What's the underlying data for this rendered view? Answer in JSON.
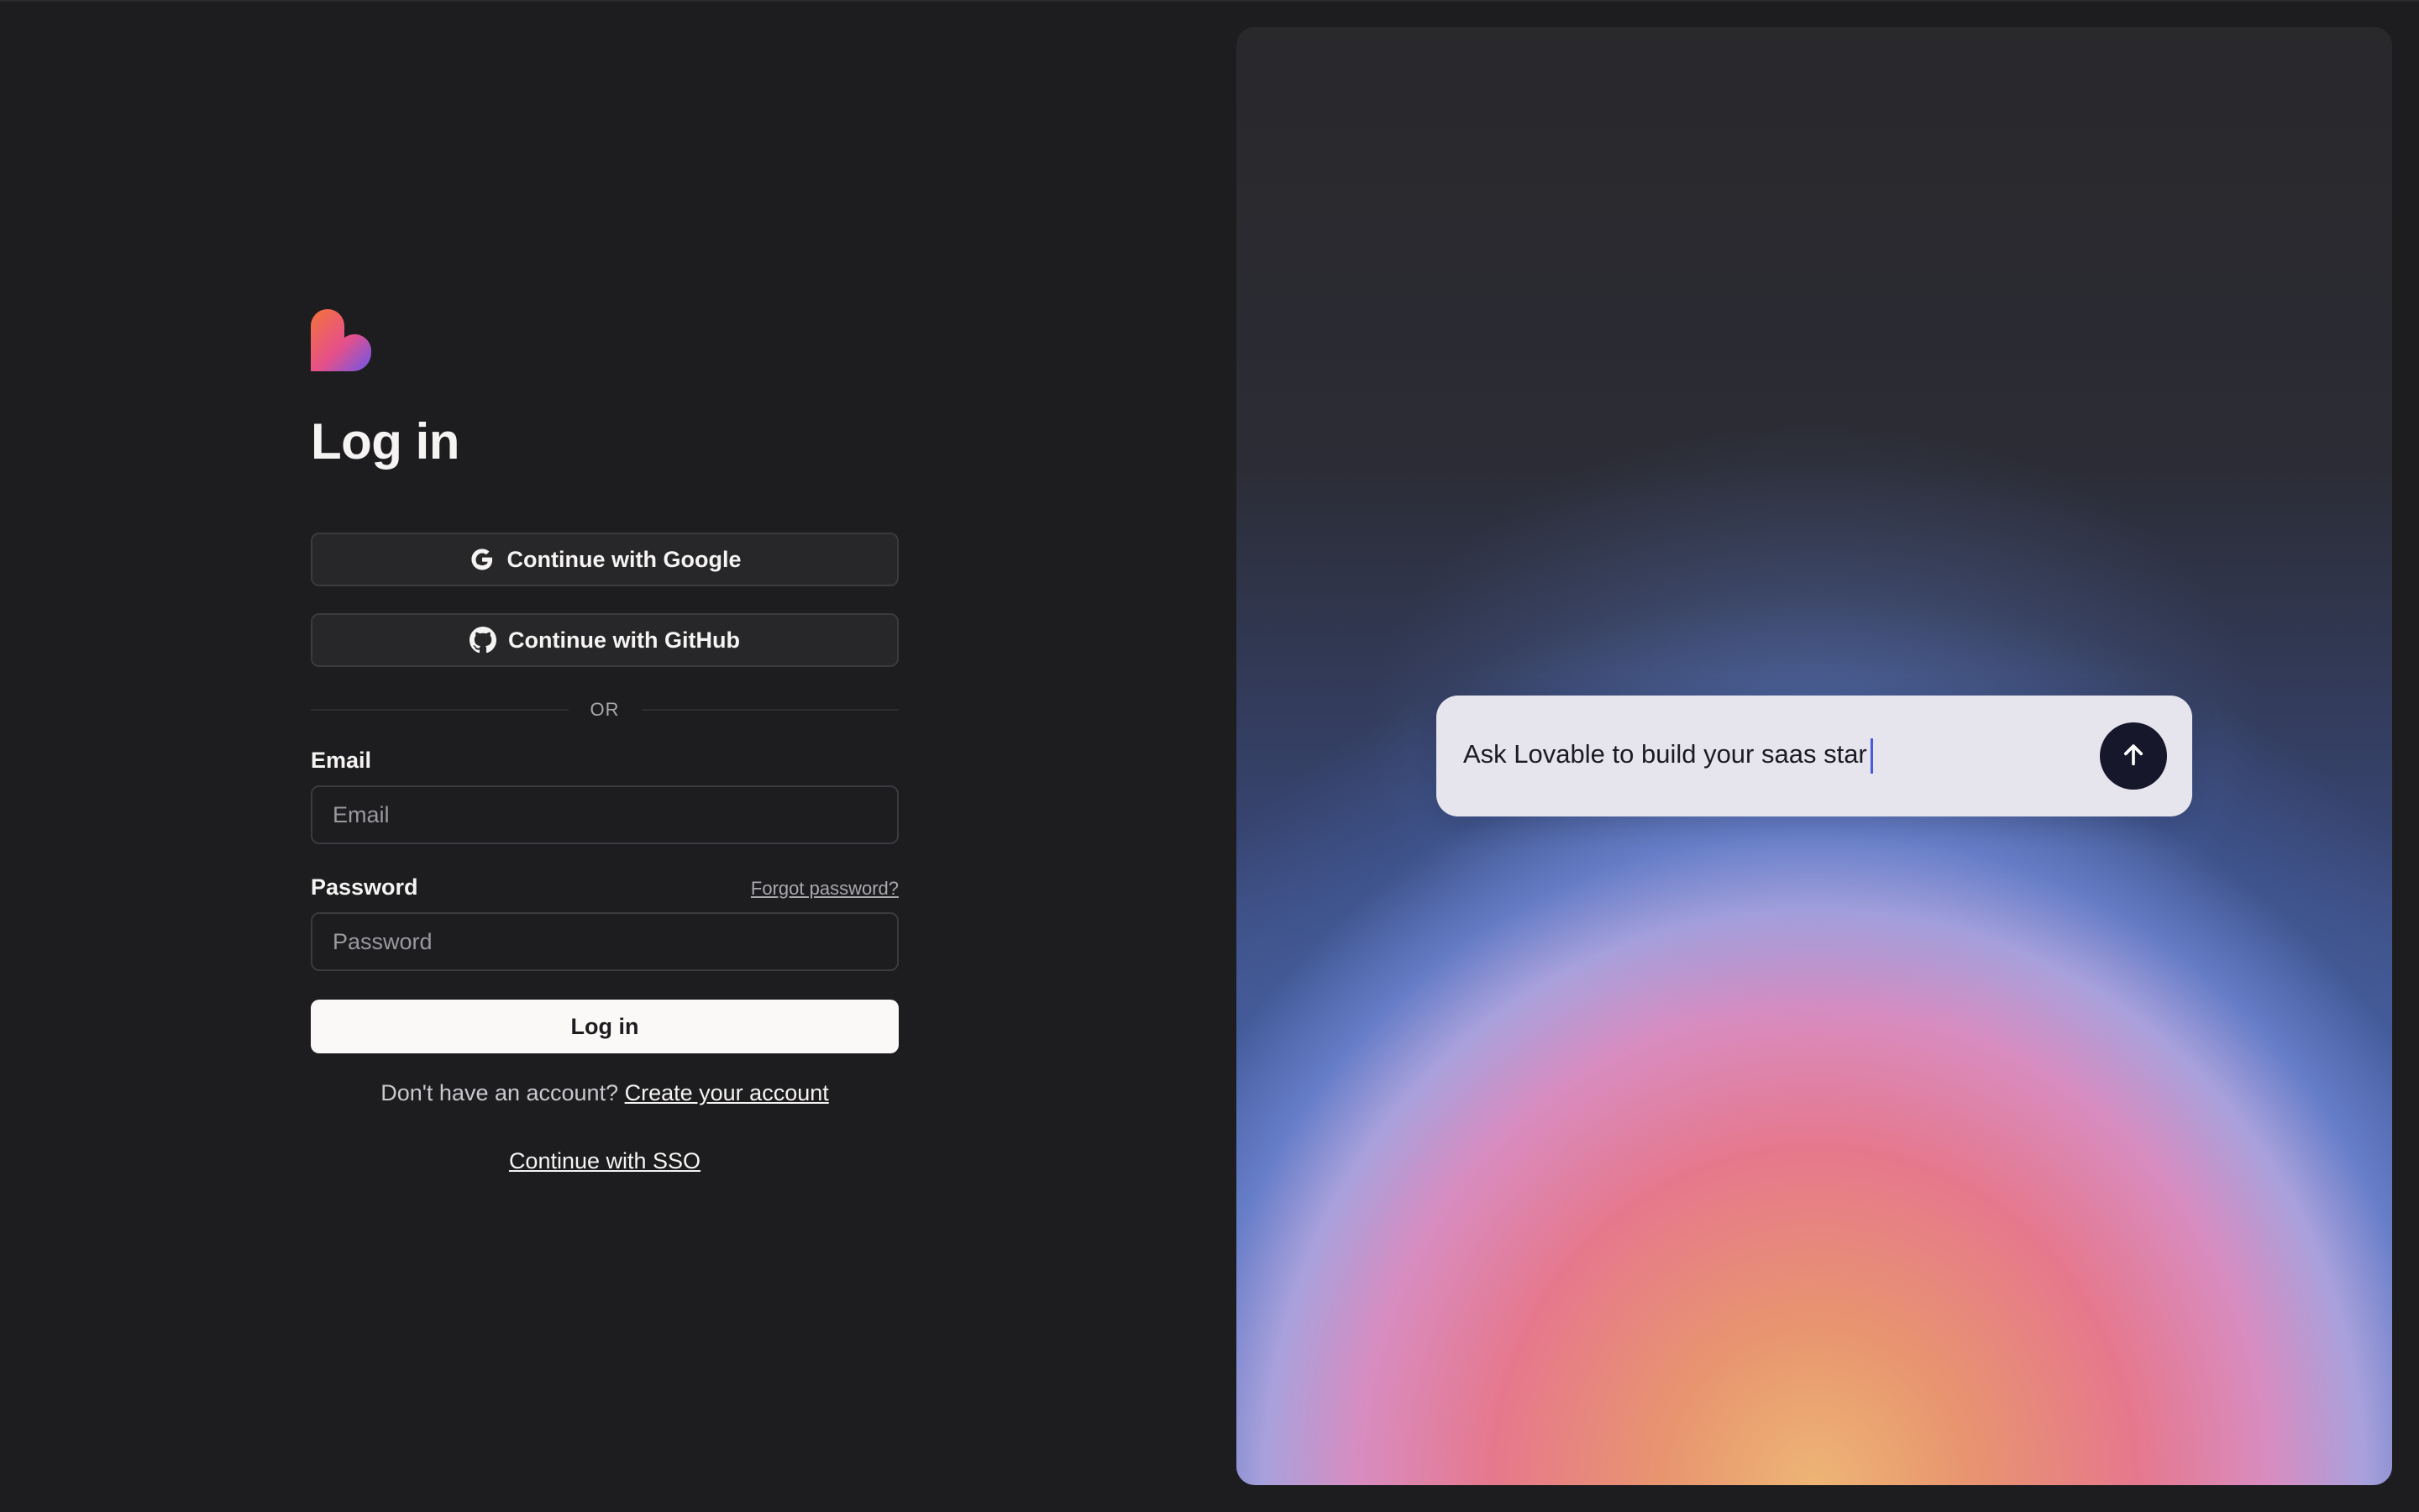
{
  "brand": {
    "logo_icon": "lovable-heart-logo",
    "logo_colors": [
      "#f26a3d",
      "#e24d8c",
      "#6a55e8"
    ]
  },
  "login": {
    "title": "Log in",
    "google_button": {
      "label": "Continue with Google",
      "icon": "google-icon"
    },
    "github_button": {
      "label": "Continue with GitHub",
      "icon": "github-icon"
    },
    "divider": "OR",
    "email": {
      "label": "Email",
      "placeholder": "Email",
      "value": ""
    },
    "password": {
      "label": "Password",
      "placeholder": "Password",
      "value": "",
      "forgot_label": "Forgot password?"
    },
    "submit_label": "Log in",
    "signup_prompt": "Don't have an account?",
    "signup_link": "Create your account",
    "sso_link": "Continue with SSO"
  },
  "hero": {
    "prompt_text": "Ask Lovable to build your saas star",
    "send_icon": "arrow-up-icon",
    "accent": "#4a5bd6"
  },
  "colors": {
    "background": "#1d1c1f",
    "button_dark": "#272629",
    "button_light": "#fbf9f7",
    "send_button": "#16172a"
  }
}
